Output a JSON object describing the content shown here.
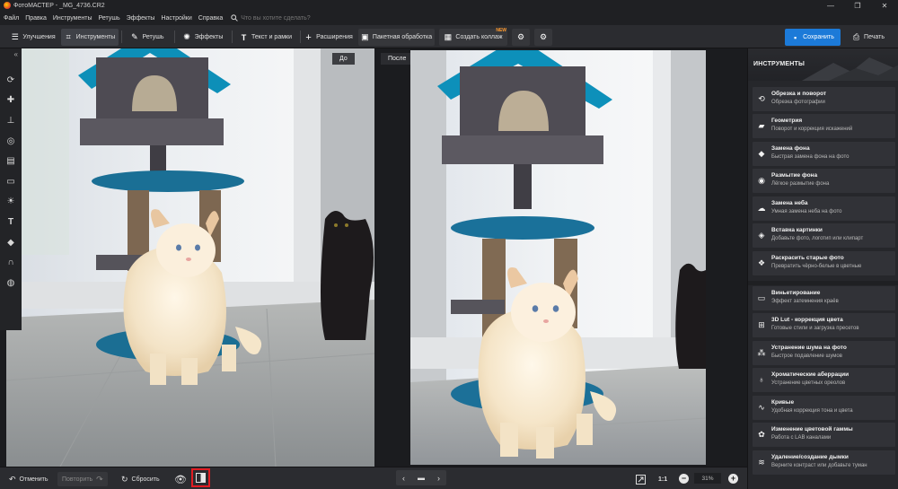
{
  "window": {
    "title": "ФотоМАСТЕР - _MG_4736.CR2",
    "minimize": "—",
    "restore": "❐",
    "close": "✕"
  },
  "menu": {
    "items": [
      "Файл",
      "Правка",
      "Инструменты",
      "Ретушь",
      "Эффекты",
      "Настройки",
      "Справка"
    ],
    "search_placeholder": "Что вы хотите сделать?"
  },
  "toolbar": {
    "tabs": [
      {
        "label": "Улучшения",
        "icon": "sliders-icon"
      },
      {
        "label": "Инструменты",
        "icon": "crop-icon",
        "active": true
      },
      {
        "label": "Ретушь",
        "icon": "brush-icon"
      },
      {
        "label": "Эффекты",
        "icon": "sparkle-icon"
      },
      {
        "label": "Текст и рамки",
        "icon": "text-icon"
      },
      {
        "label": "Расширения",
        "icon": "plus-icon"
      }
    ],
    "batch_label": "Пакетная обработка",
    "collage_label": "Создать коллаж",
    "collage_badge": "NEW",
    "save_label": "Сохранить",
    "print_label": "Печать"
  },
  "canvas": {
    "before_label": "До",
    "after_label": "После"
  },
  "panel": {
    "title": "ИНСТРУМЕНТЫ",
    "items": [
      {
        "title": "Обрезка и поворот",
        "sub": "Обрезка фотографии",
        "icon": "crop-rotate-icon"
      },
      {
        "title": "Геометрия",
        "sub": "Поворот и коррекция искажений",
        "icon": "geometry-icon"
      },
      {
        "title": "Замена фона",
        "sub": "Быстрая замена фона на фото",
        "icon": "bucket-icon"
      },
      {
        "title": "Размытие фона",
        "sub": "Лёгкое размытие фона",
        "icon": "blur-icon"
      },
      {
        "title": "Замена неба",
        "sub": "Умная замена неба на фото",
        "icon": "cloud-icon"
      },
      {
        "title": "Вставка картинки",
        "sub": "Добавьте фото, логотип или клипарт",
        "icon": "insert-image-icon"
      },
      {
        "title": "Раскрасить старые фото",
        "sub": "Превратить чёрно-белые в цветные",
        "icon": "colorize-icon"
      },
      {
        "title": "Виньетирование",
        "sub": "Эффект затемнения краёв",
        "icon": "vignette-icon"
      },
      {
        "title": "3D Lut - коррекция цвета",
        "sub": "Готовые стили и загрузка пресетов",
        "icon": "lut-icon"
      },
      {
        "title": "Устранение шума на фото",
        "sub": "Быстрое подавление шумов",
        "icon": "noise-icon"
      },
      {
        "title": "Хроматические аберрации",
        "sub": "Устранение цветных ореолов",
        "icon": "aberration-icon"
      },
      {
        "title": "Кривые",
        "sub": "Удобная коррекция тона и цвета",
        "icon": "curves-icon"
      },
      {
        "title": "Изменение цветовой гаммы",
        "sub": "Работа с LAB каналами",
        "icon": "color-wheel-icon"
      },
      {
        "title": "Удаление/создание дымки",
        "sub": "Верните контраст или добавьте туман",
        "icon": "haze-icon"
      }
    ]
  },
  "bottom": {
    "undo_label": "Отменить",
    "redo_label": "Повторить",
    "reset_label": "Сбросить",
    "ratio_label": "1:1",
    "zoom_value": "31%"
  },
  "colors": {
    "accent": "#1c7ad8",
    "highlight": "#e21c22",
    "new_badge": "#ff9a2e"
  }
}
